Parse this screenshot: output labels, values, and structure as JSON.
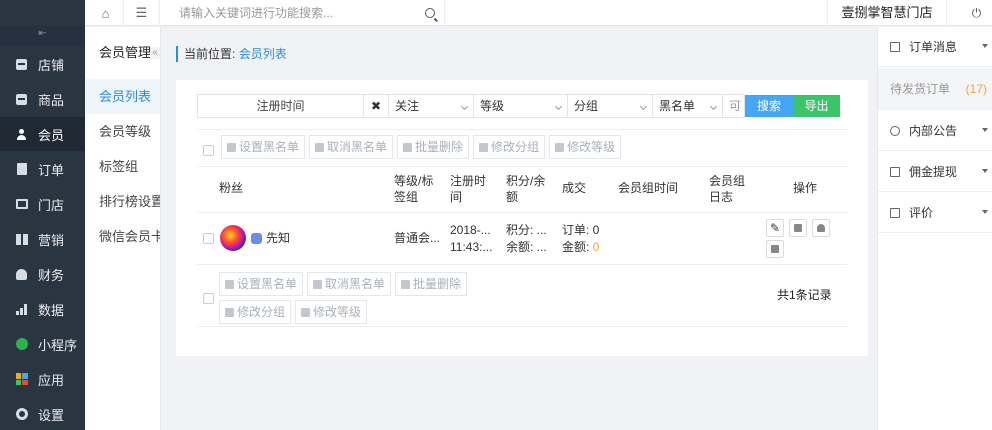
{
  "topbar": {
    "search_placeholder": "请输入关键词进行功能搜索...",
    "store_name": "壹捌掌智慧门店"
  },
  "sidebar": {
    "items": [
      {
        "label": "店铺",
        "icon": "store-icon"
      },
      {
        "label": "商品",
        "icon": "goods-icon"
      },
      {
        "label": "会员",
        "icon": "user-icon",
        "active": true
      },
      {
        "label": "订单",
        "icon": "order-icon"
      },
      {
        "label": "门店",
        "icon": "shop-icon"
      },
      {
        "label": "营销",
        "icon": "gift-icon"
      },
      {
        "label": "财务",
        "icon": "money-bag-icon"
      },
      {
        "label": "数据",
        "icon": "bar-chart-icon"
      },
      {
        "label": "小程序",
        "icon": "wechat-icon"
      },
      {
        "label": "应用",
        "icon": "apps-icon"
      },
      {
        "label": "设置",
        "icon": "gear-icon"
      }
    ]
  },
  "submenu": {
    "title": "会员管理",
    "items": [
      {
        "label": "会员列表",
        "active": true
      },
      {
        "label": "会员等级"
      },
      {
        "label": "标签组"
      },
      {
        "label": "排行榜设置"
      },
      {
        "label": "微信会员卡"
      }
    ]
  },
  "breadcrumb": {
    "prefix": "当前位置:",
    "current": "会员列表"
  },
  "filters": {
    "date": "注册时间",
    "follow": "关注",
    "level": "等级",
    "group": "分组",
    "blacklist": "黑名单",
    "extra": "可",
    "search": "搜索",
    "export": "导出"
  },
  "actions": {
    "set_blacklist": "设置黑名单",
    "cancel_blacklist": "取消黑名单",
    "batch_delete": "批量删除",
    "edit_group": "修改分组",
    "edit_level": "修改等级"
  },
  "table": {
    "headers": {
      "fans": "粉丝",
      "level_tag": "等级/标签组",
      "reg_time": "注册时间",
      "points_balance": "积分/余额",
      "deal": "成交",
      "group_time": "会员组时间",
      "group_log": "会员组日志",
      "ops": "操作"
    },
    "rows": [
      {
        "name": "先知",
        "level": "普通会...",
        "reg_date": "2018-...",
        "reg_time": "11:43:...",
        "points": "积分: ...",
        "balance": "余额: ...",
        "orders_label": "订单: ",
        "orders_value": "0",
        "amount_label": "金额: ",
        "amount_value": "0"
      }
    ],
    "total": "共1条记录"
  },
  "rightpanel": {
    "order_msg": "订单消息",
    "pending": "待发货订单",
    "pending_count": "(17)",
    "notice": "内部公告",
    "commission": "佣金提现",
    "review": "评价"
  },
  "colors": {
    "accent": "#2a8cdb",
    "search_btn": "#45a7f4",
    "export_btn": "#3cc46a",
    "sidebar_bg": "#2a3542",
    "highlight": "#f5a623"
  }
}
